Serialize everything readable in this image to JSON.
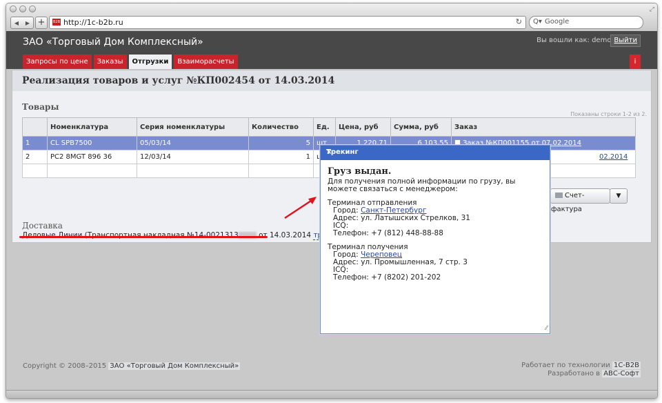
{
  "browser": {
    "url": "http://1c-b2b.ru",
    "search_placeholder": "Google",
    "favicon_text": "B2B"
  },
  "header": {
    "company": "ЗАО «Торговый Дом Комплексный»",
    "user_label": "Вы вошли как: demo |",
    "logout": "Выйти",
    "info_button": "i"
  },
  "tabs": [
    {
      "label": "Запросы по цене"
    },
    {
      "label": "Заказы"
    },
    {
      "label": "Отгрузки"
    },
    {
      "label": "Взаиморасчеты"
    }
  ],
  "document": {
    "title": "Реализация товаров и услуг №КП002454 от 14.03.2014",
    "goods_heading": "Товары",
    "shown_rows": "Показаны строки 1-2 из 2.",
    "columns": [
      "",
      "Номенклатура",
      "Серия номенклатуры",
      "Количество",
      "Ед.",
      "Цена, руб",
      "Сумма, руб",
      "Заказ"
    ],
    "rows": [
      {
        "n": "1",
        "item": "CL SPB7500",
        "series": "05/03/14",
        "qty": "5",
        "unit": "шт",
        "price": "1 220,71",
        "sum": "6 103,55",
        "order": "Заказ №КП001155 от 07.02.2014"
      },
      {
        "n": "2",
        "item": "PC2 8MGT 896 36",
        "series": "12/03/14",
        "qty": "1",
        "unit": "шт",
        "price": "",
        "sum": "",
        "order": "02.2014"
      }
    ],
    "invoice_button": "Счет-фактура",
    "invoice_caret": "▼",
    "delivery_heading": "Доставка",
    "delivery_prefix": "Деловые Линии (Транспортная накладная №14-0021313",
    "delivery_suffix": " от 14.03.2014 ",
    "tracking_link": "трекинг",
    "delivery_close": ")"
  },
  "modal": {
    "title": "Трекинг",
    "close": "×",
    "status": "Груз выдан.",
    "info": "Для получения полной информации по грузу, вы можете связаться с менеджером:",
    "origin_heading": "Терминал отправления",
    "origin_city_label": "Город: ",
    "origin_city": "Санкт-Петербург",
    "origin_address": "Адрес: ул. Латышских Стрелков, 31",
    "origin_icq": "ICQ:",
    "origin_phone": "Телефон: +7 (812) 448-88-88",
    "dest_heading": "Терминал получения",
    "dest_city_label": "Город: ",
    "dest_city": "Череповец",
    "dest_address": "Адрес: ул. Промышленная, 7 стр. 3",
    "dest_icq": "ICQ:",
    "dest_phone": "Телефон: +7 (8202) 201-202"
  },
  "footer": {
    "copyright_prefix": "Copyright © 2008–2015 ",
    "copyright_company": "ЗАО «Торговый Дом Комплексный»",
    "tech_prefix": "Работает по технологии ",
    "tech_name": "1С-B2B",
    "dev_prefix": "Разработано в ",
    "dev_name": "АВС-Софт"
  },
  "colors": {
    "header_bg": "#484848",
    "tab_red": "#c9242b",
    "selected_row": "#7a8cd0",
    "modal_title": "#3b67c7",
    "annotation_red": "#e0121a"
  }
}
